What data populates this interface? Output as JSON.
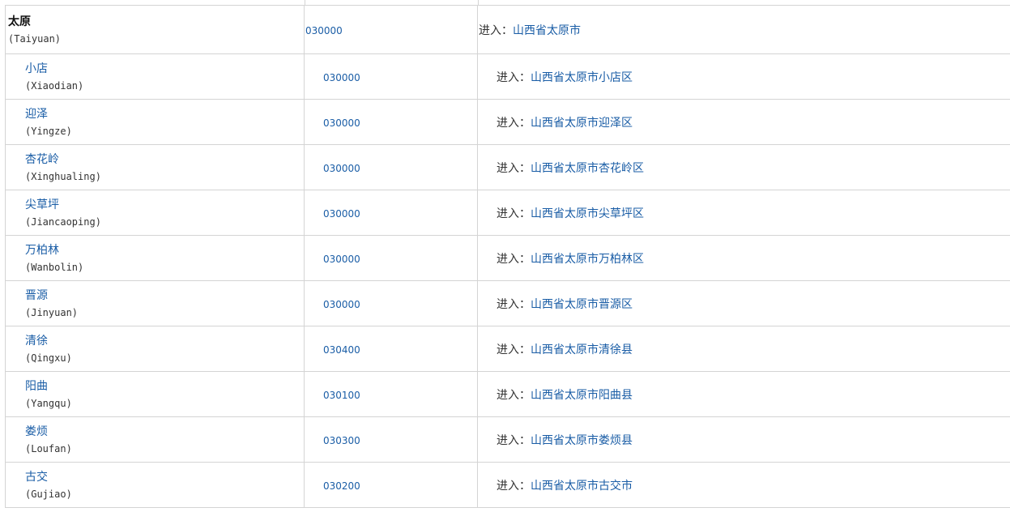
{
  "enter_label": "进入：",
  "rows": [
    {
      "name": "太原",
      "pinyin": "(Taiyuan)",
      "code": "030000",
      "region": "山西省太原市",
      "level": "city"
    },
    {
      "name": "小店",
      "pinyin": "(Xiaodian)",
      "code": "030000",
      "region": "山西省太原市小店区",
      "level": "district"
    },
    {
      "name": "迎泽",
      "pinyin": "(Yingze)",
      "code": "030000",
      "region": "山西省太原市迎泽区",
      "level": "district"
    },
    {
      "name": "杏花岭",
      "pinyin": "(Xinghualing)",
      "code": "030000",
      "region": "山西省太原市杏花岭区",
      "level": "district"
    },
    {
      "name": "尖草坪",
      "pinyin": "(Jiancaoping)",
      "code": "030000",
      "region": "山西省太原市尖草坪区",
      "level": "district"
    },
    {
      "name": "万柏林",
      "pinyin": "(Wanbolin)",
      "code": "030000",
      "region": "山西省太原市万柏林区",
      "level": "district"
    },
    {
      "name": "晋源",
      "pinyin": "(Jinyuan)",
      "code": "030000",
      "region": "山西省太原市晋源区",
      "level": "district"
    },
    {
      "name": "清徐",
      "pinyin": "(Qingxu)",
      "code": "030400",
      "region": "山西省太原市清徐县",
      "level": "district"
    },
    {
      "name": "阳曲",
      "pinyin": "(Yangqu)",
      "code": "030100",
      "region": "山西省太原市阳曲县",
      "level": "district"
    },
    {
      "name": "娄烦",
      "pinyin": "(Loufan)",
      "code": "030300",
      "region": "山西省太原市娄烦县",
      "level": "district"
    },
    {
      "name": "古交",
      "pinyin": "(Gujiao)",
      "code": "030200",
      "region": "山西省太原市古交市",
      "level": "district"
    }
  ]
}
